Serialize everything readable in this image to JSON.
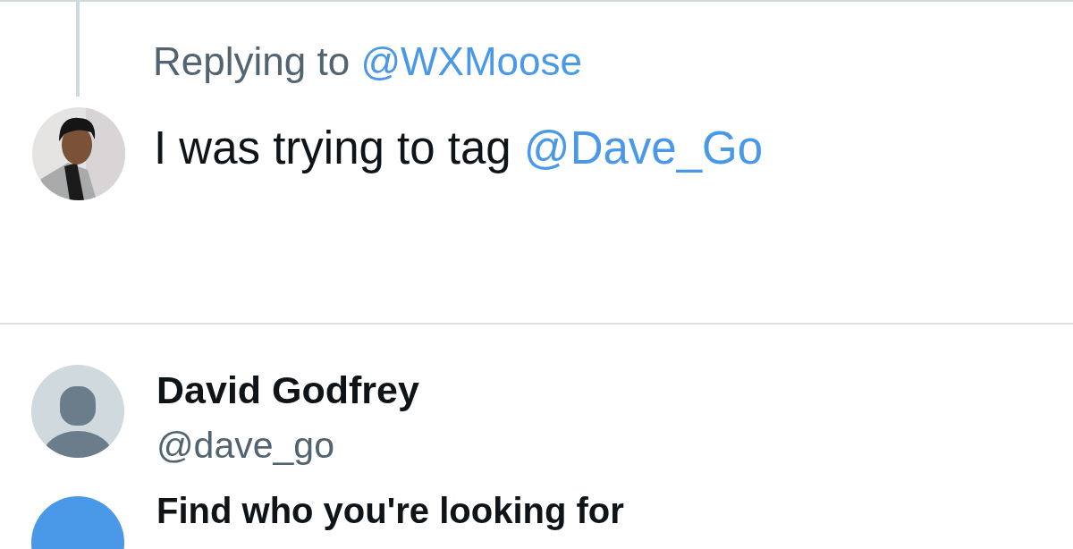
{
  "reply_context": {
    "label": "Replying to",
    "handle": "@WXMoose"
  },
  "draft": {
    "text": "I was trying to tag",
    "mention": "@Dave_Go"
  },
  "suggestions": [
    {
      "kind": "user",
      "name": "David Godfrey",
      "handle": "@dave_go"
    },
    {
      "kind": "search",
      "label": "Find who you're looking for"
    }
  ]
}
